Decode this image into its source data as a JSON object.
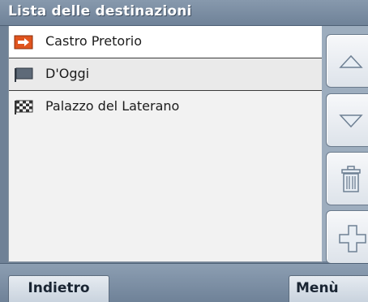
{
  "header": {
    "title": "Lista delle destinazioni"
  },
  "destinations": [
    {
      "label": "Castro Pretorio",
      "icon": "arrow-flag-icon",
      "selected": true
    },
    {
      "label": "D'Oggi",
      "icon": "flag-icon",
      "selected": false
    },
    {
      "label": "Palazzo del Laterano",
      "icon": "checkered-flag-icon",
      "selected": false
    }
  ],
  "sidebar": {
    "buttons": [
      {
        "icon": "arrow-up-icon"
      },
      {
        "icon": "arrow-down-icon"
      },
      {
        "icon": "trash-icon"
      },
      {
        "icon": "plus-icon"
      }
    ]
  },
  "footer": {
    "back_label": "Indietro",
    "menu_label": "Menù"
  },
  "colors": {
    "accent_orange": "#e0541e",
    "header_blue": "#6f8196",
    "button_light": "#dde3ea"
  }
}
